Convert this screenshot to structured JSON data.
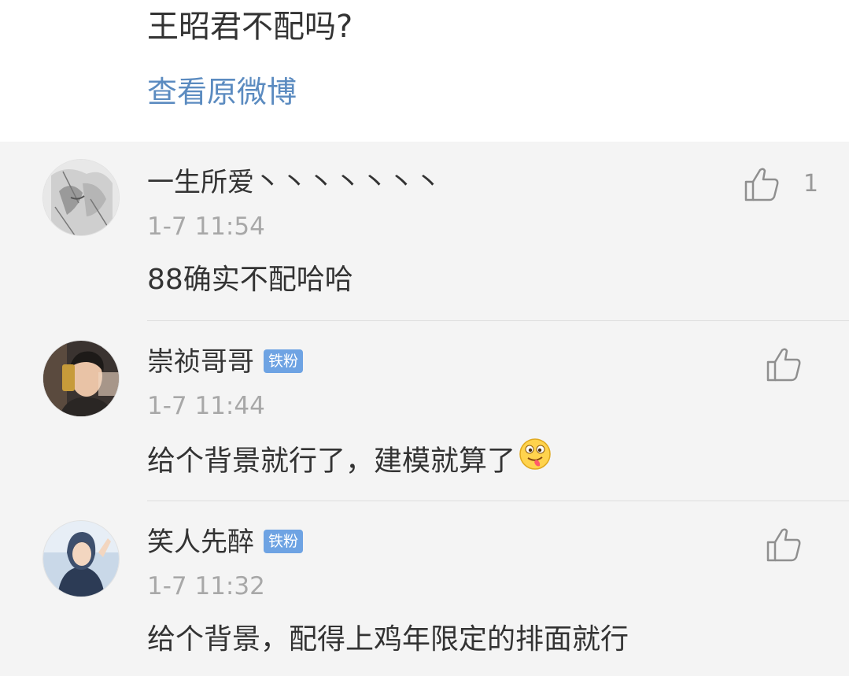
{
  "post": {
    "text": "王昭君不配吗?",
    "view_original_label": "查看原微博"
  },
  "comments": [
    {
      "username": "一生所爱丶丶丶丶丶丶丶",
      "time": "1-7 11:54",
      "text": "88确实不配哈哈",
      "likes": "1",
      "badge": ""
    },
    {
      "username": "崇祯哥哥",
      "badge": "铁粉",
      "time": "1-7 11:44",
      "text": "给个背景就行了，建模就算了",
      "emoji": "tongue-out-emoji"
    },
    {
      "username": "笑人先醉",
      "badge": "铁粉",
      "time": "1-7 11:32",
      "text": "给个背景，配得上鸡年限定的排面就行"
    }
  ],
  "colors": {
    "link": "#5b8bc0",
    "badge": "#6ea3e3",
    "comments_bg": "#f4f4f4",
    "text": "#333333",
    "meta": "#a8a8a8"
  }
}
